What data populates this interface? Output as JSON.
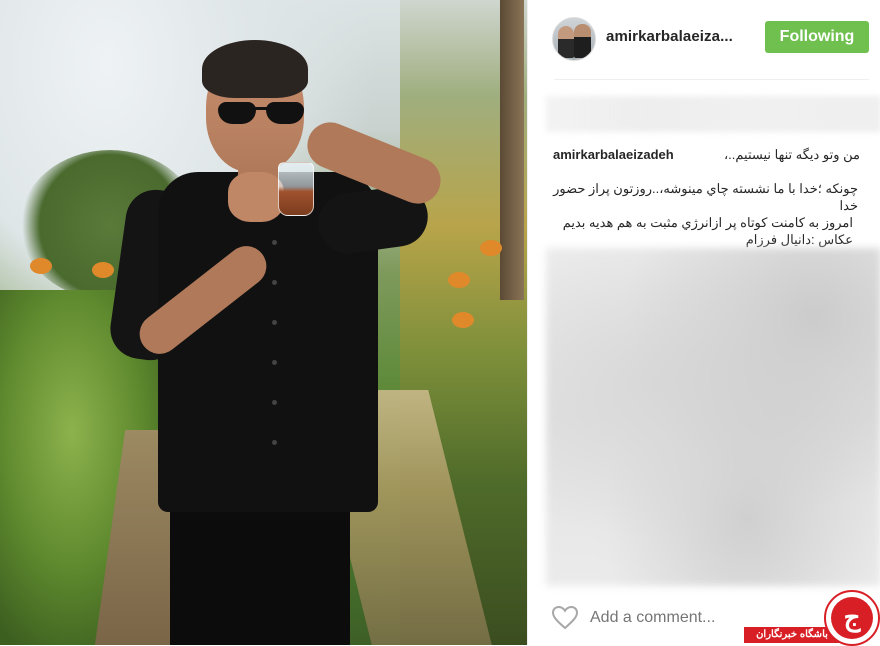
{
  "post": {
    "username": "amirkarbalaeiza...",
    "follow_button_label": "Following",
    "caption": {
      "username": "amirkarbalaeizadeh",
      "line1": "من وتو ديگه تنها نيستيم..،",
      "line2": "چونکه ؛خدا با ما نشسته چاي مينوشه،..روزتون پراز حضور خدا",
      "line3": "امروز به کامنت کوتاه پر ازانرژي مثبت به هم هديه بديم",
      "line4": "عکاس :دانيال فرزام"
    }
  },
  "comment": {
    "placeholder": "Add a comment..."
  },
  "watermark": {
    "logo_glyph": "ج",
    "label": "باشگاه خبرنگاران"
  },
  "colors": {
    "follow_button": "#70c050",
    "watermark_red": "#d81f26"
  }
}
